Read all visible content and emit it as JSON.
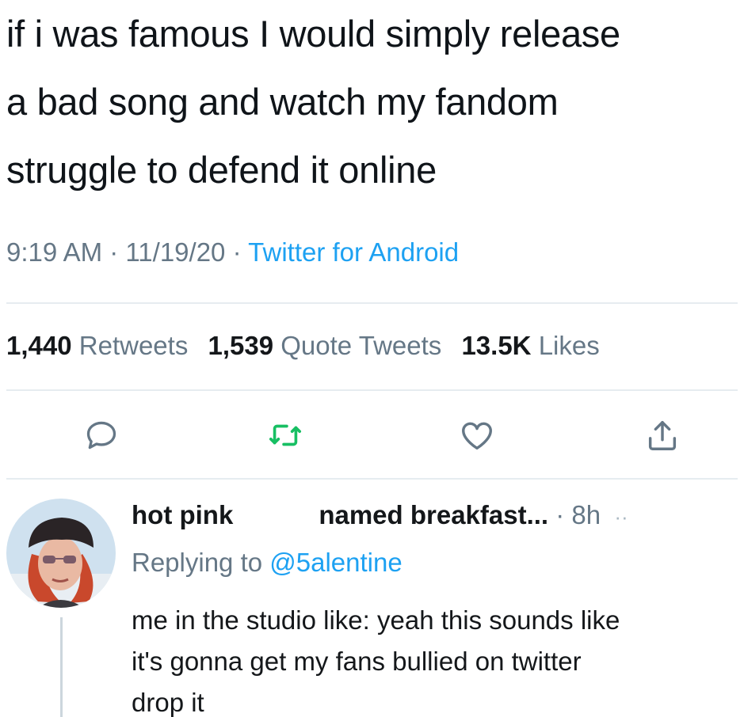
{
  "tweet": {
    "text_lines": [
      "if i was famous I would simply release",
      "a bad song and watch my fandom",
      "struggle to defend it online"
    ],
    "time": "9:19 AM",
    "date": "11/19/20",
    "separator": " · ",
    "source": "Twitter for Android",
    "stats": {
      "retweets_count": "1,440",
      "retweets_label": "Retweets",
      "quotes_count": "1,539",
      "quotes_label": "Quote Tweets",
      "likes_count": "13.5K",
      "likes_label": "Likes"
    },
    "actions": [
      {
        "icon": "reply-icon",
        "color": "#657786"
      },
      {
        "icon": "retweet-icon",
        "color": "#17bf63"
      },
      {
        "icon": "like-icon",
        "color": "#657786"
      },
      {
        "icon": "share-icon",
        "color": "#657786"
      }
    ]
  },
  "reply": {
    "name_part1": "hot pink",
    "name_part2": "named breakfast...",
    "time": "· 8h",
    "more": "··",
    "replying_prefix": "Replying to ",
    "replying_handle": "@5alentine",
    "body_lines": [
      "me in the studio like: yeah this sounds like",
      "it's gonna get my fans bullied on twitter",
      "drop it"
    ]
  },
  "colors": {
    "text": "#14171a",
    "secondary": "#657786",
    "accent": "#1da1f2",
    "retweet_green": "#17bf63",
    "divider": "#e6ecf0"
  }
}
